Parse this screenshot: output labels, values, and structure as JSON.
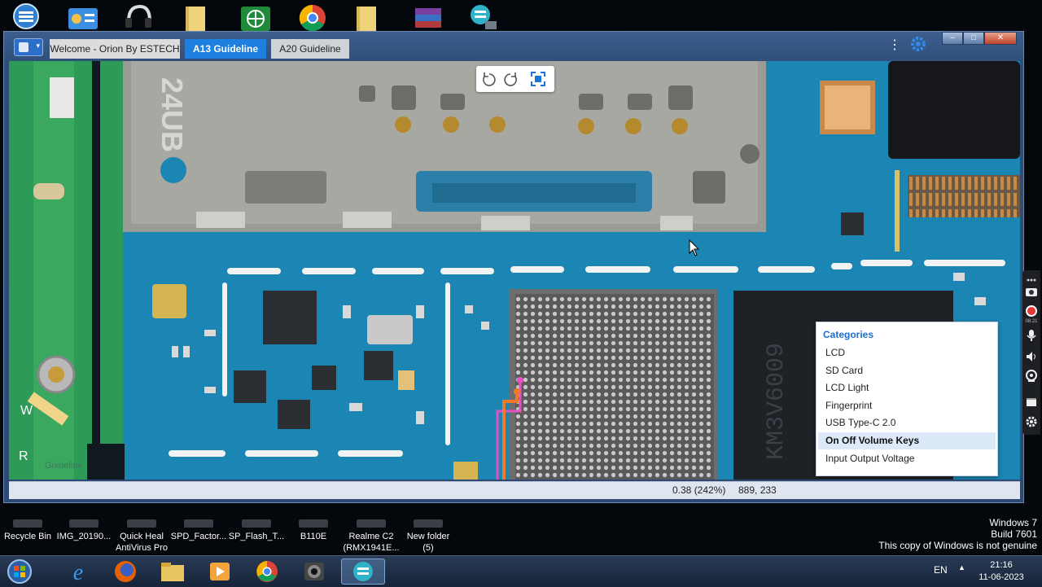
{
  "desktop": {
    "top_icons": [
      "orion-icon",
      "control-panel-icon",
      "headset-icon",
      "folder-icon",
      "network-icon",
      "chrome-icon",
      "folder-icon",
      "winrar-icon",
      "orion-tool-icon"
    ],
    "bottom_labels": [
      {
        "name": "recycle-bin",
        "label": "Recycle Bin",
        "label2": ""
      },
      {
        "name": "img-file",
        "label": "IMG_20190...",
        "label2": ""
      },
      {
        "name": "quick-heal",
        "label": "Quick Heal",
        "label2": "AntiVirus Pro"
      },
      {
        "name": "spd-factory",
        "label": "SPD_Factor...",
        "label2": ""
      },
      {
        "name": "sp-flash",
        "label": "SP_Flash_T...",
        "label2": ""
      },
      {
        "name": "b110e",
        "label": "B110E",
        "label2": ""
      },
      {
        "name": "realme-c2",
        "label": "Realme C2",
        "label2": "(RMX1941E..."
      },
      {
        "name": "new-folder",
        "label": "New folder",
        "label2": "(5)"
      }
    ],
    "watermark": {
      "line1": "Windows 7",
      "line2": "Build 7601",
      "line3": "This copy of Windows is not genuine"
    }
  },
  "window": {
    "tabs": [
      {
        "label": "Welcome - Orion By ESTECH"
      },
      {
        "label": "A13 Guideline"
      },
      {
        "label": "A20 Guideline"
      }
    ],
    "active_tab": "A13 Guideline",
    "kebab": "⋮",
    "controls": {
      "minimize": "–",
      "maximize": "□",
      "close": "✕"
    }
  },
  "board": {
    "silk_text": "24UB",
    "label_w": "W",
    "label_r": "R",
    "faint_text": "Guideline"
  },
  "image_toolbar": [
    "rotate-left-icon",
    "rotate-right-icon",
    "fit-screen-icon"
  ],
  "status": {
    "zoom": "0.38 (242%)",
    "coords": "889, 233"
  },
  "categories": {
    "title": "Categories",
    "items": [
      "LCD",
      "SD Card",
      "LCD Light",
      "Fingerprint",
      "USB Type-C 2.0",
      "On Off Volume Keys",
      "Input Output Voltage"
    ],
    "selected": "On Off Volume Keys"
  },
  "side_toolbar": {
    "time": "08:21"
  },
  "taskbar": {
    "items": [
      "start-orb",
      "ie-icon",
      "firefox-icon",
      "explorer-icon",
      "media-player-icon",
      "chrome-icon",
      "camera-app-icon",
      "orion-app-icon"
    ],
    "language": "EN",
    "time": "21:16",
    "date": "11-06-2023"
  },
  "colors": {
    "accent": "#1d7fe0",
    "board": "#1b86b3",
    "category_title": "#1a6fd1",
    "selected_row": "#dce9f8"
  }
}
